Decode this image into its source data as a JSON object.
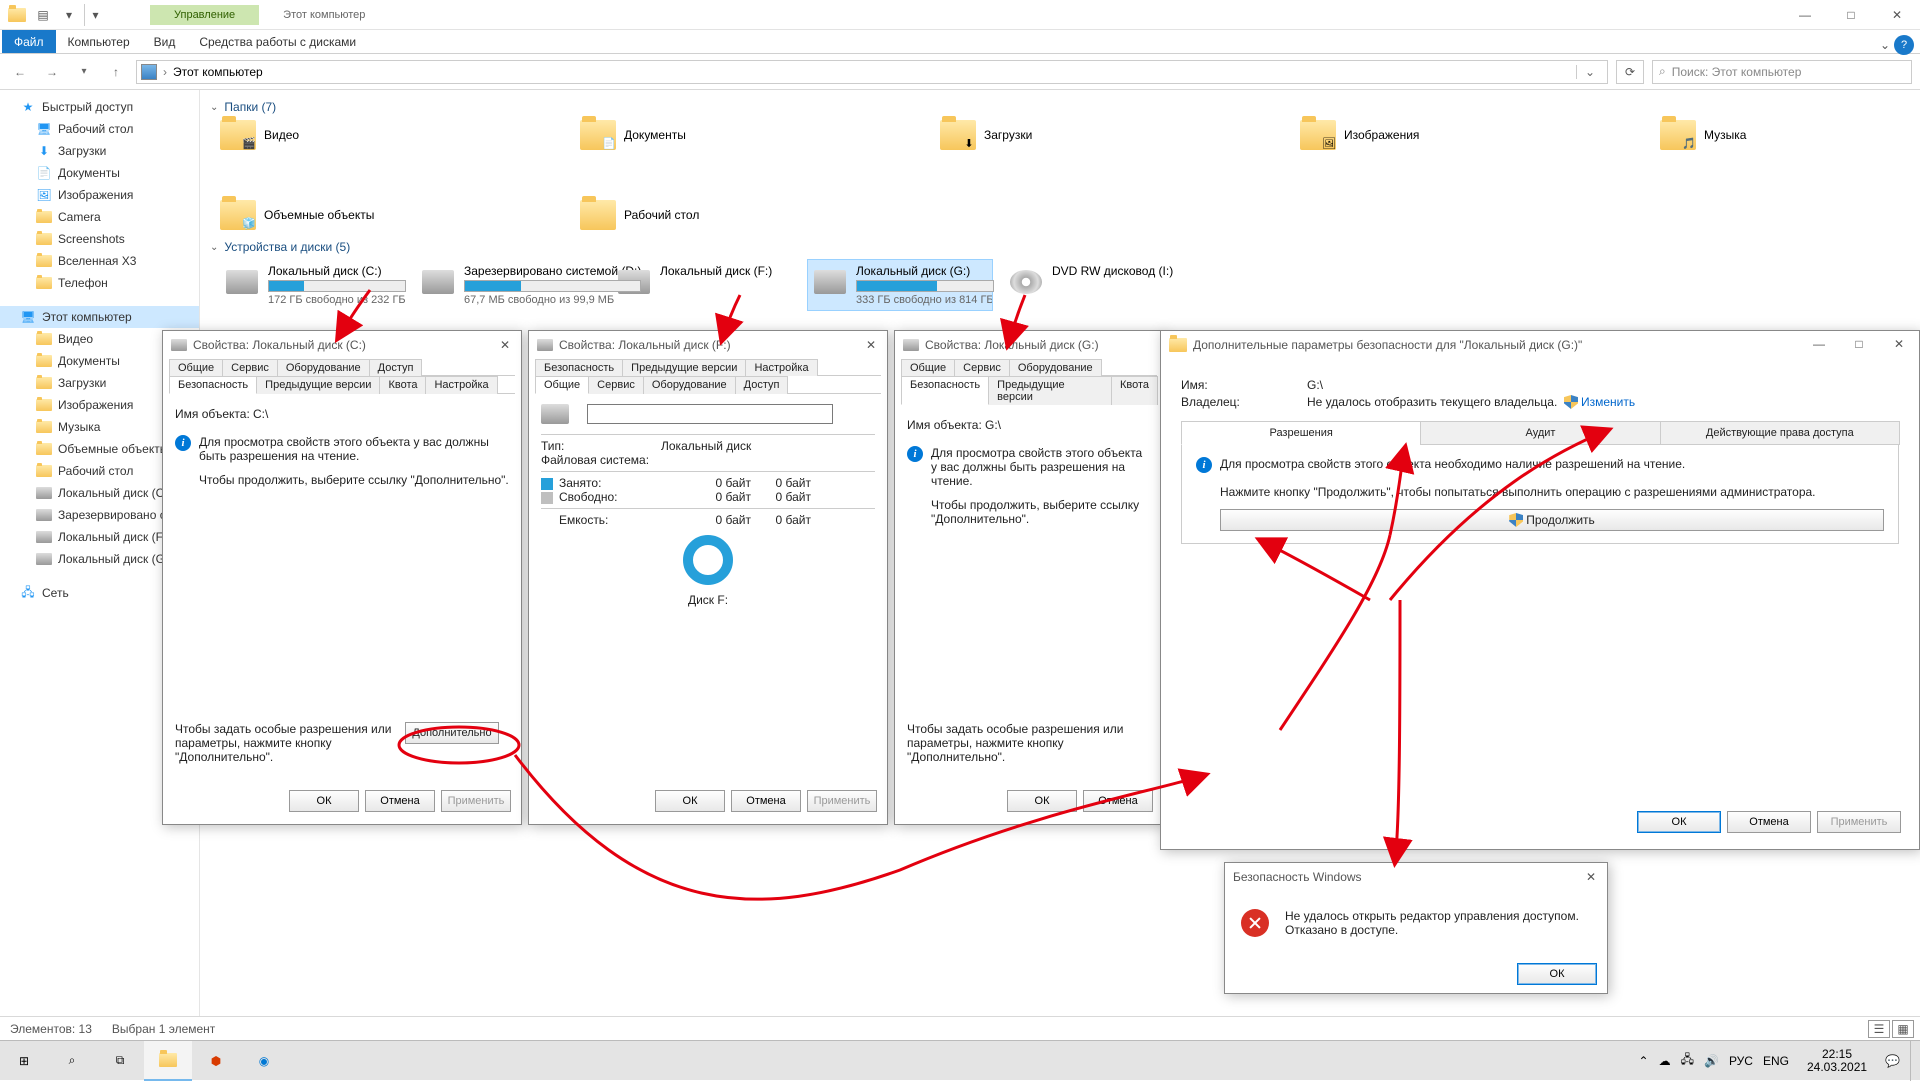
{
  "title_bar": {
    "ctx_group": "Управление",
    "ctx_title": "Этот компьютер"
  },
  "ribbon": {
    "file": "Файл",
    "tabs": [
      "Компьютер",
      "Вид"
    ],
    "ctx_tab": "Средства работы с дисками"
  },
  "address": {
    "path": "Этот компьютер",
    "search_ph": "Поиск: Этот компьютер"
  },
  "nav": {
    "quick": "Быстрый доступ",
    "quick_items": [
      "Рабочий стол",
      "Загрузки",
      "Документы",
      "Изображения",
      "Camera",
      "Screenshots",
      "Вселенная X3",
      "Телефон"
    ],
    "this_pc": "Этот компьютер",
    "pc_items": [
      "Видео",
      "Документы",
      "Загрузки",
      "Изображения",
      "Музыка",
      "Объемные объекты",
      "Рабочий стол",
      "Локальный диск (C:)",
      "Зарезервировано системой",
      "Локальный диск (F:)",
      "Локальный диск (G:)"
    ],
    "network": "Сеть"
  },
  "groups": {
    "folders": "Папки (7)",
    "drives": "Устройства и диски (5)"
  },
  "folders": [
    "Видео",
    "Документы",
    "Загрузки",
    "Изображения",
    "Музыка",
    "Объемные объекты",
    "Рабочий стол"
  ],
  "drives": [
    {
      "name": "Локальный диск (C:)",
      "free": "172 ГБ свободно из 232 ГБ",
      "fill": 26
    },
    {
      "name": "Зарезервировано системой (D:)",
      "free": "67,7 МБ свободно из 99,9 МБ",
      "fill": 32
    },
    {
      "name": "Локальный диск (F:)",
      "free": "",
      "fill": 0,
      "nobar": true
    },
    {
      "name": "Локальный диск (G:)",
      "free": "333 ГБ свободно из 814 ГБ",
      "fill": 59,
      "sel": true
    },
    {
      "name": "DVD RW дисковод (I:)",
      "free": "",
      "dvd": true,
      "nobar": true
    }
  ],
  "status": {
    "items": "Элементов: 13",
    "sel": "Выбран 1 элемент"
  },
  "taskbar": {
    "time": "22:15",
    "date": "24.03.2021",
    "lang": "РУС",
    "kbd": "ENG"
  },
  "propC": {
    "title": "Свойства: Локальный диск (C:)",
    "tabs_top": [
      "Общие",
      "Сервис",
      "Оборудование",
      "Доступ"
    ],
    "tabs_bot": [
      "Безопасность",
      "Предыдущие версии",
      "Квота",
      "Настройка"
    ],
    "obj_label": "Имя объекта:",
    "obj": "C:\\",
    "msg": "Для просмотра свойств этого объекта у вас должны быть разрешения на чтение.",
    "msg2": "Чтобы продолжить, выберите ссылку \"Дополнительно\".",
    "perm_hint": "Чтобы задать особые разрешения или параметры, нажмите кнопку \"Дополнительно\".",
    "adv": "Дополнительно",
    "ok": "ОК",
    "cancel": "Отмена",
    "apply": "Применить"
  },
  "propF": {
    "title": "Свойства: Локальный диск (F:)",
    "tabs_top": [
      "Безопасность",
      "Предыдущие версии",
      "Настройка"
    ],
    "tabs_bot": [
      "Общие",
      "Сервис",
      "Оборудование",
      "Доступ"
    ],
    "type_l": "Тип:",
    "type": "Локальный диск",
    "fs_l": "Файловая система:",
    "used_l": "Занято:",
    "used": "0 байт",
    "used2": "0 байт",
    "free_l": "Свободно:",
    "free": "0 байт",
    "free2": "0 байт",
    "cap_l": "Емкость:",
    "cap": "0 байт",
    "cap2": "0 байт",
    "chart": "Диск F:",
    "ok": "ОК",
    "cancel": "Отмена",
    "apply": "Применить"
  },
  "propG": {
    "title": "Свойства: Локальный диск (G:)",
    "tabs_top": [
      "Общие",
      "Сервис",
      "Оборудование"
    ],
    "tabs_bot": [
      "Безопасность",
      "Предыдущие версии",
      "Квота"
    ],
    "obj_label": "Имя объекта:",
    "obj": "G:\\",
    "msg": "Для просмотра свойств этого объекта у вас должны быть разрешения на чтение.",
    "msg2": "Чтобы продолжить, выберите ссылку \"Дополнительно\".",
    "perm_hint": "Чтобы задать особые разрешения или параметры, нажмите кнопку \"Дополнительно\".",
    "ok": "ОК",
    "cancel": "Отмена"
  },
  "advsec": {
    "title": "Дополнительные параметры безопасности для \"Локальный диск (G:)\"",
    "name_l": "Имя:",
    "name": "G:\\",
    "owner_l": "Владелец:",
    "owner": "Не удалось отобразить текущего владельца.",
    "change": "Изменить",
    "tabs": [
      "Разрешения",
      "Аудит",
      "Действующие права доступа"
    ],
    "msg": "Для просмотра свойств этого объекта необходимо наличие разрешений на чтение.",
    "msg2": "Нажмите кнопку \"Продолжить\", чтобы попытаться выполнить операцию с разрешениями администратора.",
    "cont": "Продолжить",
    "ok": "ОК",
    "cancel": "Отмена",
    "apply": "Применить"
  },
  "err": {
    "title": "Безопасность Windows",
    "msg1": "Не удалось открыть редактор управления доступом.",
    "msg2": "Отказано в доступе.",
    "ok": "ОК"
  }
}
